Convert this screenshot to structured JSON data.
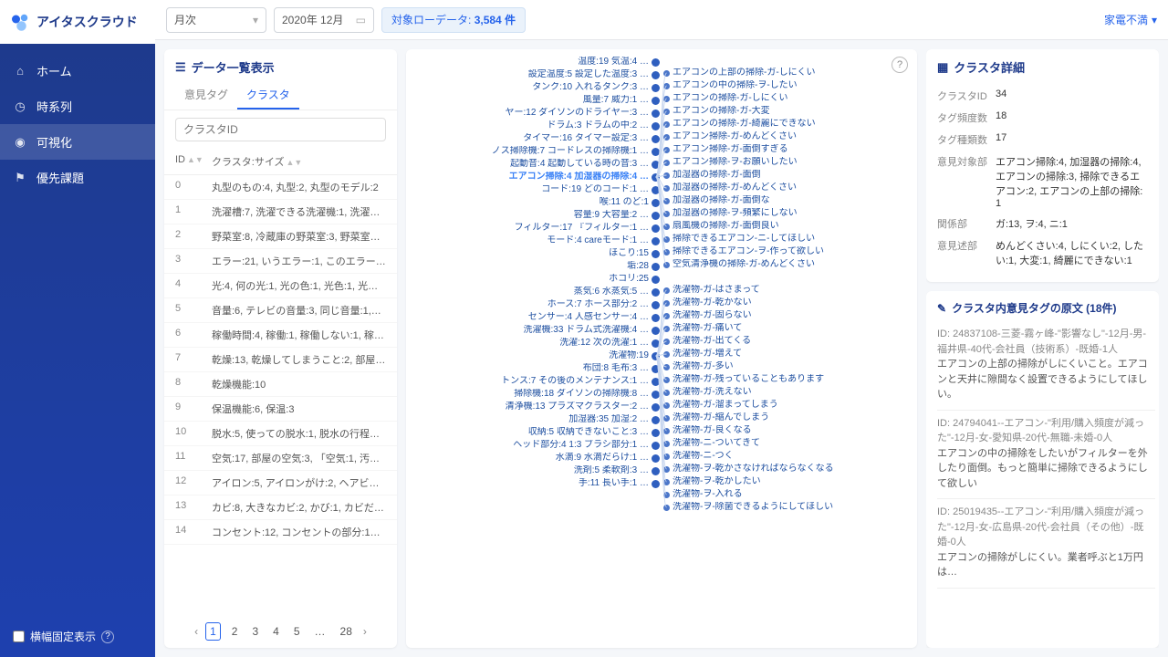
{
  "brand": "アイタスクラウド",
  "sidebar": {
    "items": [
      {
        "icon": "home",
        "label": "ホーム"
      },
      {
        "icon": "clock",
        "label": "時系列"
      },
      {
        "icon": "eye",
        "label": "可視化",
        "active": true
      },
      {
        "icon": "flag",
        "label": "優先課題"
      }
    ],
    "footer": {
      "checkbox_label": "横幅固定表示",
      "help": "?"
    }
  },
  "topbar": {
    "period_select": "月次",
    "date": "2020年 12月",
    "rowcount_label": "対象ローデータ:",
    "rowcount_value": "3,584 件",
    "right_label": "家電不満"
  },
  "left_panel": {
    "title": "データ一覧表示",
    "tabs": [
      {
        "label": "意見タグ"
      },
      {
        "label": "クラスタ",
        "active": true
      }
    ],
    "filter_placeholder": "クラスタID",
    "columns": {
      "id": "ID",
      "size": "クラスタ:サイズ"
    },
    "rows": [
      {
        "id": "0",
        "size": "丸型のもの:4, 丸型:2, 丸型のモデル:2"
      },
      {
        "id": "1",
        "size": "洗濯槽:7, 洗濯できる洗濯機:1, 洗濯…"
      },
      {
        "id": "2",
        "size": "野菜室:8, 冷蔵庫の野菜室:3, 野菜室…"
      },
      {
        "id": "3",
        "size": "エラー:21, いうエラー:1, このエラー…"
      },
      {
        "id": "4",
        "size": "光:4, 何の光:1, 光の色:1, 光色:1, 光色…"
      },
      {
        "id": "5",
        "size": "音量:6, テレビの音量:3, 同じ音量:1,…"
      },
      {
        "id": "6",
        "size": "稼働時間:4, 稼働:1, 稼働しない:1, 稼…"
      },
      {
        "id": "7",
        "size": "乾燥:13, 乾燥してしまうこと:2, 部屋…"
      },
      {
        "id": "8",
        "size": "乾燥機能:10"
      },
      {
        "id": "9",
        "size": "保温機能:6, 保温:3"
      },
      {
        "id": "10",
        "size": "脱水:5, 使っての脱水:1, 脱水の行程…"
      },
      {
        "id": "11",
        "size": "空気:17, 部屋の空気:3, 「空気:1, 汚…"
      },
      {
        "id": "12",
        "size": "アイロン:5, アイロンがけ:2, ヘアビ…"
      },
      {
        "id": "13",
        "size": "カビ:8, 大きなカビ:2, かび:1, カビだ…"
      },
      {
        "id": "14",
        "size": "コンセント:12, コンセントの部分:1…"
      }
    ],
    "pagination": {
      "pages": [
        "1",
        "2",
        "3",
        "4",
        "5",
        "…",
        "28"
      ],
      "active": "1"
    }
  },
  "viz": {
    "left_nodes": [
      "温度:19 気温:4 …",
      "設定温度:5 設定した温度:3 …",
      "タンク:10 入れるタンク:3 …",
      "風量:7 威力:1 …",
      "ヤー:12 ダイソンのドライヤー:3 …",
      "ドラム:3 ドラムの中:2 …",
      "タイマー:16 タイマー設定:3 …",
      "ノス掃除機:7 コードレスの掃除機:1 …",
      "起動音:4 起動している時の音:3 …",
      {
        "text": "エアコン掃除:4 加湿器の掃除:4 …",
        "selected": true
      },
      "コード:19 どのコード:1 …",
      "喉:11 のど:1",
      "容量:9 大容量:2 …",
      "フィルター:17 『フィルター:1 …",
      "モード:4 careモード:1 …",
      "ほこり:15",
      "垢:28",
      "ホコリ:25",
      "蒸気:6 水蒸気:5 …",
      "ホース:7 ホース部分:2 …",
      "センサー:4 人感センサー:4 …",
      "洗濯機:33 ドラム式洗濯機:4 …",
      "洗濯:12 次の洗濯:1 …",
      "洗濯物:19",
      "布団:8 毛布:3 …",
      "トンス:7 その後のメンテナンス:1 …",
      "掃除機:18 ダイソンの掃除機:8 …",
      "清浄機:13 プラズマクラスター:2 …",
      "加湿器:35 加湿:2 …",
      "収納:5 収納できないこと:3 …",
      "ヘッド部分:4 1:3 ブラシ部分:1 …",
      "水滴:9 水滴だらけ:1 …",
      "洗剤:5 柔軟剤:3 …",
      "手:11 長い手:1 …"
    ],
    "right_groups": [
      {
        "items": [
          "エアコンの上部の掃除-ガ-しにくい",
          "エアコンの中の掃除-ヲ-したい",
          "エアコンの掃除-ガ-しにくい",
          "エアコンの掃除-ガ-大変",
          "エアコンの掃除-ガ-綺麗にできない",
          "エアコン掃除-ガ-めんどくさい",
          "エアコン掃除-ガ-面倒すぎる",
          "エアコン掃除-ヲ-お願いしたい",
          "加湿器の掃除-ガ-面倒",
          "加湿器の掃除-ガ-めんどくさい",
          "加湿器の掃除-ガ-面倒な",
          "加湿器の掃除-ヲ-頻繁にしない",
          "扇風機の掃除-ガ-面倒良い",
          "掃除できるエアコン-ニ-してほしい",
          "掃除できるエアコン-ヲ-作って欲しい",
          "空気清浄機の掃除-ガ-めんどくさい"
        ]
      },
      {
        "items": [
          "洗濯物-ガ-はさまって",
          "洗濯物-ガ-乾かない",
          "洗濯物-ガ-固らない",
          "洗濯物-ガ-痛いて",
          "洗濯物-ガ-出てくる",
          "洗濯物-ガ-増えて",
          "洗濯物-ガ-多い",
          "洗濯物-ガ-残っていることもあります",
          "洗濯物-ガ-洗えない",
          "洗濯物-ガ-溜まってしまう",
          "洗濯物-ガ-縮んでしまう",
          "洗濯物-ガ-良くなる",
          "洗濯物-ニ-ついてきて",
          "洗濯物-ニ-つく",
          "洗濯物-ヲ-乾かさなければならなくなる",
          "洗濯物-ヲ-乾かしたい",
          "洗濯物-ヲ-入れる",
          "洗濯物-ヲ-除菌できるようにしてほしい"
        ]
      }
    ]
  },
  "detail": {
    "title": "クラスタ詳細",
    "rows": [
      {
        "k": "クラスタID",
        "v": "34"
      },
      {
        "k": "タグ頻度数",
        "v": "18"
      },
      {
        "k": "タグ種類数",
        "v": "17"
      },
      {
        "k": "意見対象部",
        "v": "エアコン掃除:4, 加湿器の掃除:4, エアコンの掃除:3, 掃除できるエアコン:2, エアコンの上部の掃除:1"
      },
      {
        "k": "関係部",
        "v": "ガ:13, ヲ:4, ニ:1"
      },
      {
        "k": "意見述部",
        "v": "めんどくさい:4, しにくい:2, したい:1, 大変:1, 綺麗にできない:1"
      }
    ]
  },
  "originals": {
    "title": "クラスタ内意見タグの原文 (18件)",
    "items": [
      {
        "meta": "ID: 24837108-三菱-霧ヶ峰-\"影響なし\"-12月-男-福井県-40代-会社員（技術系）-既婚-1人",
        "body": "エアコンの上部の掃除がしにくいこと。エアコンと天井に隙間なく設置できるようにしてほしい。"
      },
      {
        "meta": "ID: 24794041--エアコン-\"利用/購入頻度が減った\"-12月-女-愛知県-20代-無職-未婚-0人",
        "body": "エアコンの中の掃除をしたいがフィルターを外したり面倒。もっと簡単に掃除できるようにして欲しい"
      },
      {
        "meta": "ID: 25019435--エアコン-\"利用/購入頻度が減った\"-12月-女-広島県-20代-会社員（その他）-既婚-0人",
        "body": "エアコンの掃除がしにくい。業者呼ぶと1万円は…"
      }
    ]
  }
}
